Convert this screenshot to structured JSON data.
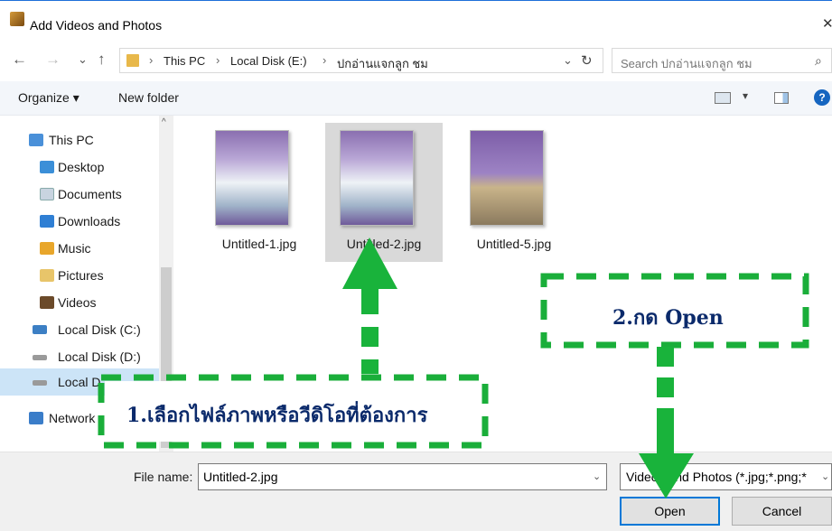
{
  "window": {
    "title": "Add Videos and Photos",
    "close_glyph": "✕"
  },
  "address": {
    "back": "←",
    "forward": "→",
    "recent": "⌄",
    "up": "↑",
    "breadcrumb": [
      "This PC",
      "Local Disk (E:)",
      "ปกอ่านแจกลูก ชม"
    ],
    "separator": "›",
    "dropdown": "⌄",
    "refresh": "↻",
    "search_placeholder": "Search ปกอ่านแจกลูก ชม",
    "search_icon": "⌕"
  },
  "toolbar": {
    "organize": "Organize ▾",
    "new_folder": "New folder",
    "view_caret": "▾",
    "help": "?"
  },
  "nav": {
    "scroll_up": "^",
    "items": [
      {
        "label": "This PC",
        "icon": "computer-icon",
        "color": "#4a90d9"
      },
      {
        "label": "Desktop",
        "icon": "desktop-icon",
        "color": "#3b8fd8"
      },
      {
        "label": "Documents",
        "icon": "documents-icon",
        "color": "#c8d4e0"
      },
      {
        "label": "Downloads",
        "icon": "downloads-icon",
        "color": "#2f7fd4"
      },
      {
        "label": "Music",
        "icon": "music-icon",
        "color": "#e8a62b"
      },
      {
        "label": "Pictures",
        "icon": "pictures-icon",
        "color": "#e8c56a"
      },
      {
        "label": "Videos",
        "icon": "videos-icon",
        "color": "#6b4a2a"
      },
      {
        "label": "Local Disk (C:)",
        "icon": "drive-c-icon",
        "color": "#3c7fc4"
      },
      {
        "label": "Local Disk (D:)",
        "icon": "drive-d-icon",
        "color": "#9a9a9a"
      },
      {
        "label": "Local D",
        "icon": "drive-e-icon",
        "color": "#9a9a9a"
      },
      {
        "label": "Network",
        "icon": "network-icon",
        "color": "#3a7dc9"
      }
    ]
  },
  "files": [
    {
      "name": "Untitled-1.jpg",
      "selected": false
    },
    {
      "name": "Untitled-2.jpg",
      "selected": true
    },
    {
      "name": "Untitled-5.jpg",
      "selected": false
    }
  ],
  "bottom": {
    "file_name_label": "File name:",
    "file_name_value": "Untitled-2.jpg",
    "file_name_caret": "⌄",
    "file_type_value": "Videos and Photos (*.jpg;*.png;*",
    "file_type_caret": "⌄",
    "open_label": "Open",
    "cancel_label": "Cancel"
  },
  "annotations": {
    "step1": "1.เลือกไฟล์ภาพหรือวีดิโอที่ต้องการ",
    "step2": "2.กด Open",
    "color_dash": "#1aae3a",
    "color_arrow": "#19b33b"
  }
}
